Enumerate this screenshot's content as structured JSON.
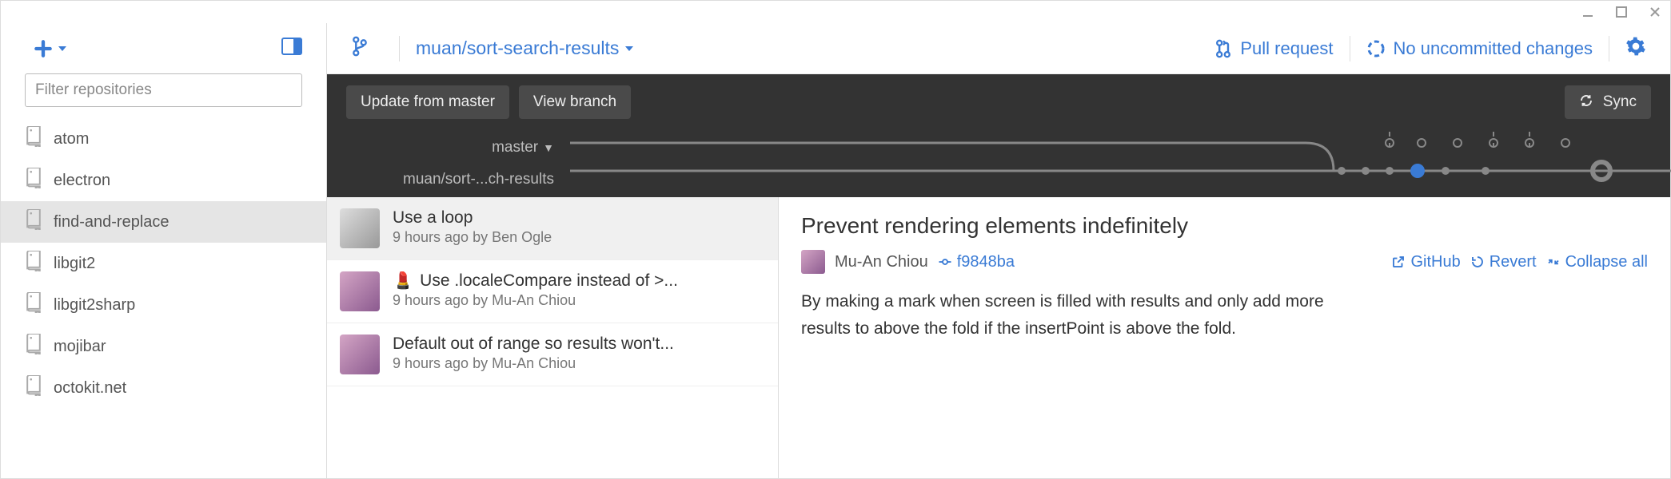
{
  "sidebar": {
    "filter_placeholder": "Filter repositories",
    "repos": [
      {
        "name": "atom",
        "active": false
      },
      {
        "name": "electron",
        "active": false
      },
      {
        "name": "find-and-replace",
        "active": true
      },
      {
        "name": "libgit2",
        "active": false
      },
      {
        "name": "libgit2sharp",
        "active": false
      },
      {
        "name": "mojibar",
        "active": false
      },
      {
        "name": "octokit.net",
        "active": false
      }
    ]
  },
  "topbar": {
    "branch": "muan/sort-search-results",
    "pull_request": "Pull request",
    "changes": "No uncommitted changes"
  },
  "toolbar": {
    "update": "Update from master",
    "view_branch": "View branch",
    "sync": "Sync"
  },
  "graph": {
    "master_label": "master",
    "branch_label": "muan/sort-...ch-results"
  },
  "commits": [
    {
      "title": "Use a loop",
      "meta": "9 hours ago by Ben Ogle",
      "emoji": "",
      "avatar": "grey",
      "active": true
    },
    {
      "title": "Use .localeCompare instead of >...",
      "meta": "9 hours ago by Mu-An Chiou",
      "emoji": "💄",
      "avatar": "colored",
      "active": false
    },
    {
      "title": "Default out of range so results won't...",
      "meta": "9 hours ago by Mu-An Chiou",
      "emoji": "",
      "avatar": "colored",
      "active": false
    }
  ],
  "detail": {
    "title": "Prevent rendering elements indefinitely",
    "author": "Mu-An Chiou",
    "sha": "f9848ba",
    "github": "GitHub",
    "revert": "Revert",
    "collapse": "Collapse all",
    "body": "By making a mark when screen is filled with results and only add more results to above the fold if the insertPoint is above the fold."
  }
}
